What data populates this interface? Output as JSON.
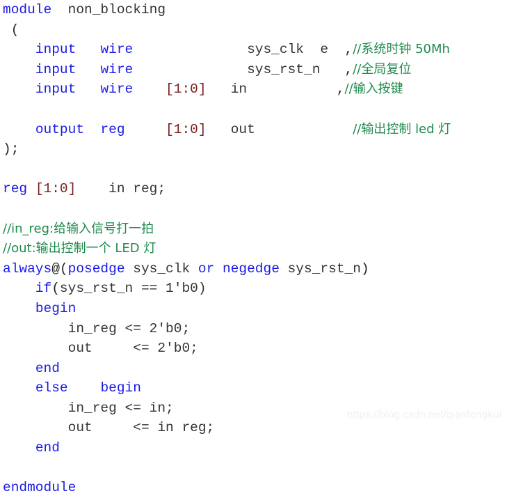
{
  "document": {
    "kind": "verilog-source-listing",
    "language": "Verilog",
    "colors": {
      "background": "#ffffff",
      "keyword": "#1a1ae6",
      "identifier": "#333333",
      "comment": "#1f8a4c",
      "range": "#7a2020",
      "punctuation": "#222222",
      "watermark": "#f0f0f0"
    },
    "watermark": "https://blog.csdn.net/qianfengkui"
  },
  "lines": [
    {
      "index": 0,
      "text": "module  non_blocking",
      "tokens": [
        {
          "t": "module",
          "c": "kw"
        },
        {
          "t": "  ",
          "c": "punc"
        },
        {
          "t": "non_blocking",
          "c": "ident"
        }
      ]
    },
    {
      "index": 1,
      "text": " (",
      "tokens": [
        {
          "t": " (",
          "c": "punc"
        }
      ]
    },
    {
      "index": 2,
      "text": "    input   wire          sys_clk  e  ,//系统时钟 50Mh",
      "tokens": [
        {
          "t": "    ",
          "c": "punc"
        },
        {
          "t": "input",
          "c": "kw"
        },
        {
          "t": "   ",
          "c": "punc"
        },
        {
          "t": "wire",
          "c": "kw"
        },
        {
          "t": "              ",
          "c": "punc"
        },
        {
          "t": "sys_clk  e",
          "c": "ident"
        },
        {
          "t": "  ,",
          "c": "punc"
        },
        {
          "t": "//系统时钟 50Mh",
          "c": "cmt"
        }
      ]
    },
    {
      "index": 3,
      "text": "    input   wire          sys_rst_n   ,//全局复位",
      "tokens": [
        {
          "t": "    ",
          "c": "punc"
        },
        {
          "t": "input",
          "c": "kw"
        },
        {
          "t": "   ",
          "c": "punc"
        },
        {
          "t": "wire",
          "c": "kw"
        },
        {
          "t": "              ",
          "c": "punc"
        },
        {
          "t": "sys_rst_n",
          "c": "ident"
        },
        {
          "t": "   ,",
          "c": "punc"
        },
        {
          "t": "//全局复位",
          "c": "cmt"
        }
      ]
    },
    {
      "index": 4,
      "text": "    input   wire   [1:0]   in          ,//输入按键",
      "tokens": [
        {
          "t": "    ",
          "c": "punc"
        },
        {
          "t": "input",
          "c": "kw"
        },
        {
          "t": "   ",
          "c": "punc"
        },
        {
          "t": "wire",
          "c": "kw"
        },
        {
          "t": "    ",
          "c": "punc"
        },
        {
          "t": "[1:0]",
          "c": "range"
        },
        {
          "t": "   ",
          "c": "punc"
        },
        {
          "t": "in",
          "c": "ident"
        },
        {
          "t": "           ,",
          "c": "punc"
        },
        {
          "t": "//输入按键",
          "c": "cmt"
        }
      ]
    },
    {
      "index": 5,
      "text": "",
      "tokens": []
    },
    {
      "index": 6,
      "text": "    output  reg    [1:0]   out          //输出控制 led 灯",
      "tokens": [
        {
          "t": "    ",
          "c": "punc"
        },
        {
          "t": "output",
          "c": "kw"
        },
        {
          "t": "  ",
          "c": "punc"
        },
        {
          "t": "reg",
          "c": "kw"
        },
        {
          "t": "     ",
          "c": "punc"
        },
        {
          "t": "[1:0]",
          "c": "range"
        },
        {
          "t": "   ",
          "c": "punc"
        },
        {
          "t": "out",
          "c": "ident"
        },
        {
          "t": "            ",
          "c": "punc"
        },
        {
          "t": "//输出控制 led 灯",
          "c": "cmt"
        }
      ]
    },
    {
      "index": 7,
      "text": ");",
      "tokens": [
        {
          "t": ");",
          "c": "punc"
        }
      ]
    },
    {
      "index": 8,
      "text": "",
      "tokens": []
    },
    {
      "index": 9,
      "text": "reg [1:0]   in reg;",
      "tokens": [
        {
          "t": "reg",
          "c": "kw"
        },
        {
          "t": " ",
          "c": "punc"
        },
        {
          "t": "[1:0]",
          "c": "range"
        },
        {
          "t": "    ",
          "c": "punc"
        },
        {
          "t": "in reg;",
          "c": "ident"
        }
      ]
    },
    {
      "index": 10,
      "text": "",
      "tokens": []
    },
    {
      "index": 11,
      "text": "//in_reg:给输入信号打一拍",
      "tokens": [
        {
          "t": "//in_reg:给输入信号打一拍",
          "c": "cmt"
        }
      ]
    },
    {
      "index": 12,
      "text": "//out:输出控制一个 LED 灯",
      "tokens": [
        {
          "t": "//out:输出控制一个 LED 灯",
          "c": "cmt"
        }
      ]
    },
    {
      "index": 13,
      "text": "always@(posedge sys_clk or negedge sys_rst_n)",
      "tokens": [
        {
          "t": "always",
          "c": "kw"
        },
        {
          "t": "@(",
          "c": "punc"
        },
        {
          "t": "posedge",
          "c": "kw"
        },
        {
          "t": " ",
          "c": "punc"
        },
        {
          "t": "sys_clk",
          "c": "ident"
        },
        {
          "t": " ",
          "c": "punc"
        },
        {
          "t": "or",
          "c": "kw"
        },
        {
          "t": " ",
          "c": "punc"
        },
        {
          "t": "negedge",
          "c": "kw"
        },
        {
          "t": " ",
          "c": "punc"
        },
        {
          "t": "sys_rst_n",
          "c": "ident"
        },
        {
          "t": ")",
          "c": "punc"
        }
      ]
    },
    {
      "index": 14,
      "text": "    if(sys_rst_n == 1'b0)",
      "tokens": [
        {
          "t": "    ",
          "c": "punc"
        },
        {
          "t": "if",
          "c": "kw"
        },
        {
          "t": "(",
          "c": "punc"
        },
        {
          "t": "sys_rst_n == 1'b0)",
          "c": "ident"
        }
      ]
    },
    {
      "index": 15,
      "text": "    begin",
      "tokens": [
        {
          "t": "    ",
          "c": "punc"
        },
        {
          "t": "begin",
          "c": "kw"
        }
      ]
    },
    {
      "index": 16,
      "text": "        in_reg <= 2'b0;",
      "tokens": [
        {
          "t": "        ",
          "c": "punc"
        },
        {
          "t": "in_reg <= 2'b0;",
          "c": "ident"
        }
      ]
    },
    {
      "index": 17,
      "text": "        out     <= 2'b0;",
      "tokens": [
        {
          "t": "        ",
          "c": "punc"
        },
        {
          "t": "out     <= 2'b0;",
          "c": "ident"
        }
      ]
    },
    {
      "index": 18,
      "text": "    end",
      "tokens": [
        {
          "t": "    ",
          "c": "punc"
        },
        {
          "t": "end",
          "c": "kw"
        }
      ]
    },
    {
      "index": 19,
      "text": "    else    begin",
      "tokens": [
        {
          "t": "    ",
          "c": "punc"
        },
        {
          "t": "else",
          "c": "kw"
        },
        {
          "t": "    ",
          "c": "punc"
        },
        {
          "t": "begin",
          "c": "kw"
        }
      ]
    },
    {
      "index": 20,
      "text": "        in_reg <= in;",
      "tokens": [
        {
          "t": "        ",
          "c": "punc"
        },
        {
          "t": "in_reg <= in;",
          "c": "ident"
        }
      ]
    },
    {
      "index": 21,
      "text": "        out     <= in reg;",
      "tokens": [
        {
          "t": "        ",
          "c": "punc"
        },
        {
          "t": "out     <= in reg;",
          "c": "ident"
        }
      ]
    },
    {
      "index": 22,
      "text": "    end",
      "tokens": [
        {
          "t": "    ",
          "c": "punc"
        },
        {
          "t": "end",
          "c": "kw"
        }
      ]
    },
    {
      "index": 23,
      "text": "",
      "tokens": []
    },
    {
      "index": 24,
      "text": "endmodule",
      "tokens": [
        {
          "t": "endmodule",
          "c": "kw"
        }
      ]
    }
  ]
}
